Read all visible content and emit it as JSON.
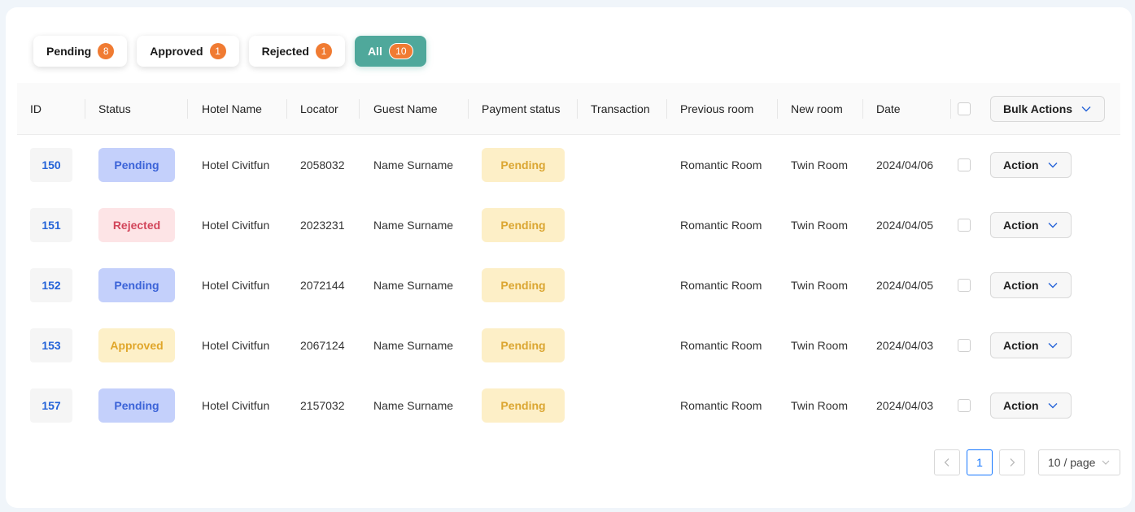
{
  "tabs": [
    {
      "label": "Pending",
      "count": "8"
    },
    {
      "label": "Approved",
      "count": "1"
    },
    {
      "label": "Rejected",
      "count": "1"
    },
    {
      "label": "All",
      "count": "10"
    }
  ],
  "columns": {
    "id": "ID",
    "status": "Status",
    "hotel": "Hotel Name",
    "locator": "Locator",
    "guest": "Guest Name",
    "payment": "Payment status",
    "transaction": "Transaction",
    "previous_room": "Previous room",
    "new_room": "New room",
    "date": "Date",
    "bulk_actions": "Bulk Actions"
  },
  "rows": [
    {
      "id": "150",
      "status": "Pending",
      "hotel": "Hotel Civitfun",
      "locator": "2058032",
      "guest": "Name Surname",
      "payment": "Pending",
      "transaction": "",
      "previous_room": "Romantic Room",
      "new_room": "Twin Room",
      "date": "2024/04/06",
      "action": "Action"
    },
    {
      "id": "151",
      "status": "Rejected",
      "hotel": "Hotel Civitfun",
      "locator": "2023231",
      "guest": "Name Surname",
      "payment": "Pending",
      "transaction": "",
      "previous_room": "Romantic Room",
      "new_room": "Twin Room",
      "date": "2024/04/05",
      "action": "Action"
    },
    {
      "id": "152",
      "status": "Pending",
      "hotel": "Hotel Civitfun",
      "locator": "2072144",
      "guest": "Name Surname",
      "payment": "Pending",
      "transaction": "",
      "previous_room": "Romantic Room",
      "new_room": "Twin Room",
      "date": "2024/04/05",
      "action": "Action"
    },
    {
      "id": "153",
      "status": "Approved",
      "hotel": "Hotel Civitfun",
      "locator": "2067124",
      "guest": "Name Surname",
      "payment": "Pending",
      "transaction": "",
      "previous_room": "Romantic Room",
      "new_room": "Twin Room",
      "date": "2024/04/03",
      "action": "Action"
    },
    {
      "id": "157",
      "status": "Pending",
      "hotel": "Hotel Civitfun",
      "locator": "2157032",
      "guest": "Name Surname",
      "payment": "Pending",
      "transaction": "",
      "previous_room": "Romantic Room",
      "new_room": "Twin Room",
      "date": "2024/04/03",
      "action": "Action"
    }
  ],
  "pagination": {
    "prev_icon": "chevron-left-icon",
    "current_page": "1",
    "next_icon": "chevron-right-icon",
    "page_size": "10 / page"
  },
  "colors": {
    "accent": "#4fa89b",
    "badge": "#f07b32",
    "link": "#2463d8"
  }
}
